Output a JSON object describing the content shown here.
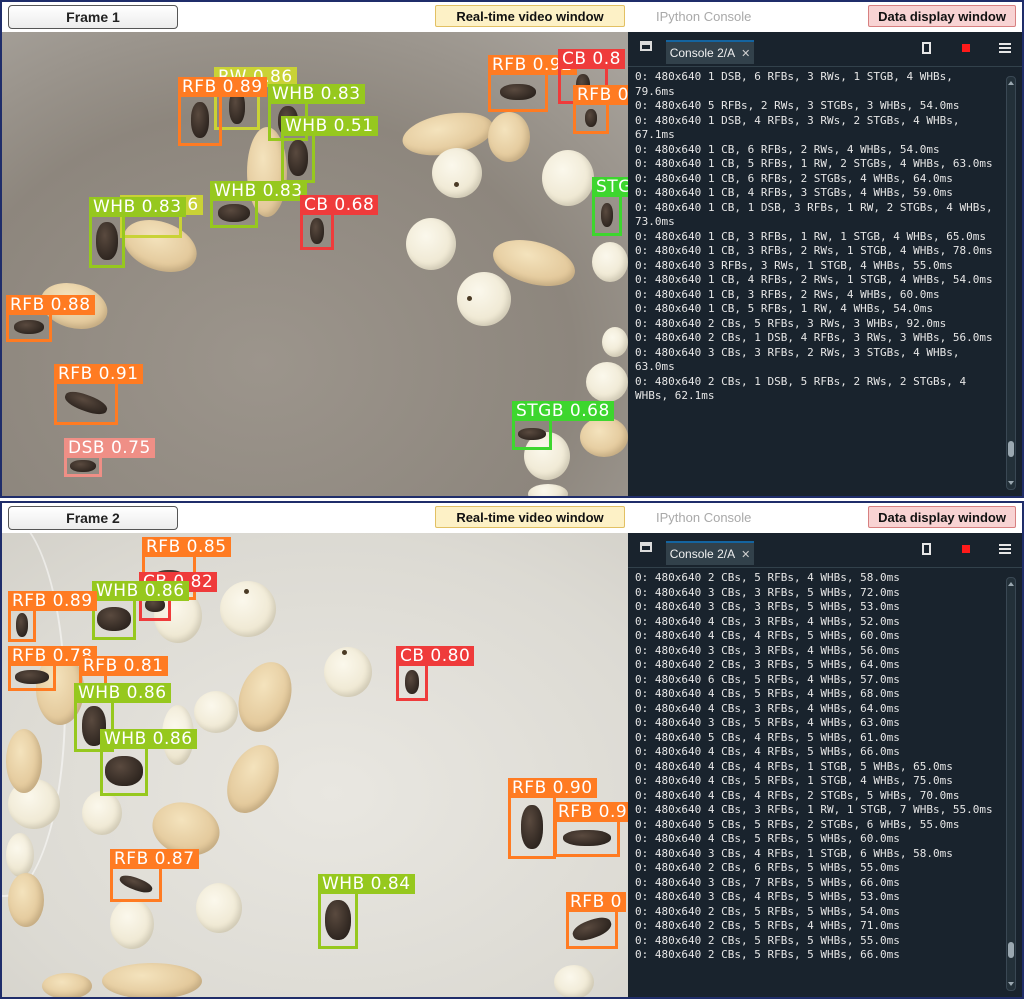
{
  "colors": {
    "RFB": "#ff7b22",
    "WHB": "#96c81e",
    "CB": "#ef3b3b",
    "STGB": "#3dd62e",
    "DSB": "#ef8f86",
    "RW": "#c9d236"
  },
  "frames": [
    {
      "label": "Frame 1",
      "video_tag": "Real-time video window",
      "data_tag": "Data display window",
      "console": {
        "title": "IPython Console",
        "tab": "Console 2/A",
        "output": "0: 480x640 1 DSB, 6 RFBs, 3 RWs, 1 STGB, 4 WHBs, 79.6ms\n0: 480x640 5 RFBs, 2 RWs, 3 STGBs, 3 WHBs, 54.0ms\n0: 480x640 1 DSB, 4 RFBs, 3 RWs, 2 STGBs, 4 WHBs, 67.1ms\n0: 480x640 1 CB, 6 RFBs, 2 RWs, 4 WHBs, 54.0ms\n0: 480x640 1 CB, 5 RFBs, 1 RW, 2 STGBs, 4 WHBs, 63.0ms\n0: 480x640 1 CB, 6 RFBs, 2 STGBs, 4 WHBs, 64.0ms\n0: 480x640 1 CB, 4 RFBs, 3 STGBs, 4 WHBs, 59.0ms\n0: 480x640 1 CB, 1 DSB, 3 RFBs, 1 RW, 2 STGBs, 4 WHBs, 73.0ms\n0: 480x640 1 CB, 3 RFBs, 1 RW, 1 STGB, 4 WHBs, 65.0ms\n0: 480x640 1 CB, 3 RFBs, 2 RWs, 1 STGB, 4 WHBs, 78.0ms\n0: 480x640 3 RFBs, 3 RWs, 1 STGB, 4 WHBs, 55.0ms\n0: 480x640 1 CB, 4 RFBs, 2 RWs, 1 STGB, 4 WHBs, 54.0ms\n0: 480x640 1 CB, 3 RFBs, 2 RWs, 4 WHBs, 60.0ms\n0: 480x640 1 CB, 5 RFBs, 1 RW, 4 WHBs, 54.0ms\n0: 480x640 2 CBs, 5 RFBs, 3 RWs, 3 WHBs, 92.0ms\n0: 480x640 2 CBs, 1 DSB, 4 RFBs, 3 RWs, 3 WHBs, 56.0ms\n0: 480x640 3 CBs, 3 RFBs, 2 RWs, 3 STGBs, 4 WHBs, 63.0ms\n0: 480x640 2 CBs, 1 DSB, 5 RFBs, 2 RWs, 2 STGBs, 4 WHBs, 62.1ms"
      },
      "detections": [
        {
          "cls": "RFB",
          "text": "RFB 0.92"
        },
        {
          "cls": "CB",
          "text": "CB 0.8"
        },
        {
          "cls": "RFB",
          "text": "RFB 0"
        },
        {
          "cls": "RW",
          "text": "RW 0.86"
        },
        {
          "cls": "RFB",
          "text": "RFB 0.89"
        },
        {
          "cls": "WHB",
          "text": "WHB 0.83"
        },
        {
          "cls": "WHB",
          "text": "WHB 0.51"
        },
        {
          "cls": "WHB",
          "text": "WHB 0.83"
        },
        {
          "cls": "RW",
          "text": "RW 0.76"
        },
        {
          "cls": "WHB",
          "text": "WHB 0.83"
        },
        {
          "cls": "CB",
          "text": "CB 0.68"
        },
        {
          "cls": "STGB",
          "text": "STG"
        },
        {
          "cls": "RFB",
          "text": "RFB 0.88"
        },
        {
          "cls": "RFB",
          "text": "RFB 0.91"
        },
        {
          "cls": "DSB",
          "text": "DSB 0.75"
        },
        {
          "cls": "STGB",
          "text": "STGB 0.68"
        }
      ]
    },
    {
      "label": "Frame 2",
      "video_tag": "Real-time video window",
      "data_tag": "Data display window",
      "console": {
        "title": "IPython Console",
        "tab": "Console 2/A",
        "output": "0: 480x640 2 CBs, 5 RFBs, 4 WHBs, 58.0ms\n0: 480x640 3 CBs, 3 RFBs, 5 WHBs, 72.0ms\n0: 480x640 3 CBs, 3 RFBs, 5 WHBs, 53.0ms\n0: 480x640 4 CBs, 3 RFBs, 4 WHBs, 52.0ms\n0: 480x640 4 CBs, 4 RFBs, 5 WHBs, 60.0ms\n0: 480x640 3 CBs, 3 RFBs, 4 WHBs, 56.0ms\n0: 480x640 2 CBs, 3 RFBs, 5 WHBs, 64.0ms\n0: 480x640 6 CBs, 5 RFBs, 4 WHBs, 57.0ms\n0: 480x640 4 CBs, 5 RFBs, 4 WHBs, 68.0ms\n0: 480x640 4 CBs, 3 RFBs, 4 WHBs, 64.0ms\n0: 480x640 3 CBs, 5 RFBs, 4 WHBs, 63.0ms\n0: 480x640 5 CBs, 4 RFBs, 5 WHBs, 61.0ms\n0: 480x640 4 CBs, 4 RFBs, 5 WHBs, 66.0ms\n0: 480x640 4 CBs, 4 RFBs, 1 STGB, 5 WHBs, 65.0ms\n0: 480x640 4 CBs, 5 RFBs, 1 STGB, 4 WHBs, 75.0ms\n0: 480x640 4 CBs, 4 RFBs, 2 STGBs, 5 WHBs, 70.0ms\n0: 480x640 4 CBs, 3 RFBs, 1 RW, 1 STGB, 7 WHBs, 55.0ms\n0: 480x640 5 CBs, 5 RFBs, 2 STGBs, 6 WHBs, 55.0ms\n0: 480x640 4 CBs, 5 RFBs, 5 WHBs, 60.0ms\n0: 480x640 3 CBs, 4 RFBs, 1 STGB, 6 WHBs, 58.0ms\n0: 480x640 2 CBs, 6 RFBs, 5 WHBs, 55.0ms\n0: 480x640 3 CBs, 7 RFBs, 5 WHBs, 66.0ms\n0: 480x640 3 CBs, 4 RFBs, 5 WHBs, 53.0ms\n0: 480x640 2 CBs, 5 RFBs, 5 WHBs, 54.0ms\n0: 480x640 2 CBs, 5 RFBs, 4 WHBs, 71.0ms\n0: 480x640 2 CBs, 5 RFBs, 5 WHBs, 55.0ms\n0: 480x640 2 CBs, 5 RFBs, 5 WHBs, 66.0ms"
      },
      "detections": [
        {
          "cls": "RFB",
          "text": "RFB 0.85"
        },
        {
          "cls": "CB",
          "text": "CB 0.82"
        },
        {
          "cls": "WHB",
          "text": "WHB 0.86"
        },
        {
          "cls": "RFB",
          "text": "RFB 0.89"
        },
        {
          "cls": "RFB",
          "text": "RFB 0.78"
        },
        {
          "cls": "RFB",
          "text": "RFB 0.81"
        },
        {
          "cls": "WHB",
          "text": "WHB 0.86"
        },
        {
          "cls": "WHB",
          "text": "WHB 0.86"
        },
        {
          "cls": "CB",
          "text": "CB 0.80"
        },
        {
          "cls": "RFB",
          "text": "RFB 0.90"
        },
        {
          "cls": "RFB",
          "text": "RFB 0.9"
        },
        {
          "cls": "RFB",
          "text": "RFB 0.87"
        },
        {
          "cls": "WHB",
          "text": "WHB 0.84"
        },
        {
          "cls": "RFB",
          "text": "RFB 0"
        }
      ]
    }
  ]
}
